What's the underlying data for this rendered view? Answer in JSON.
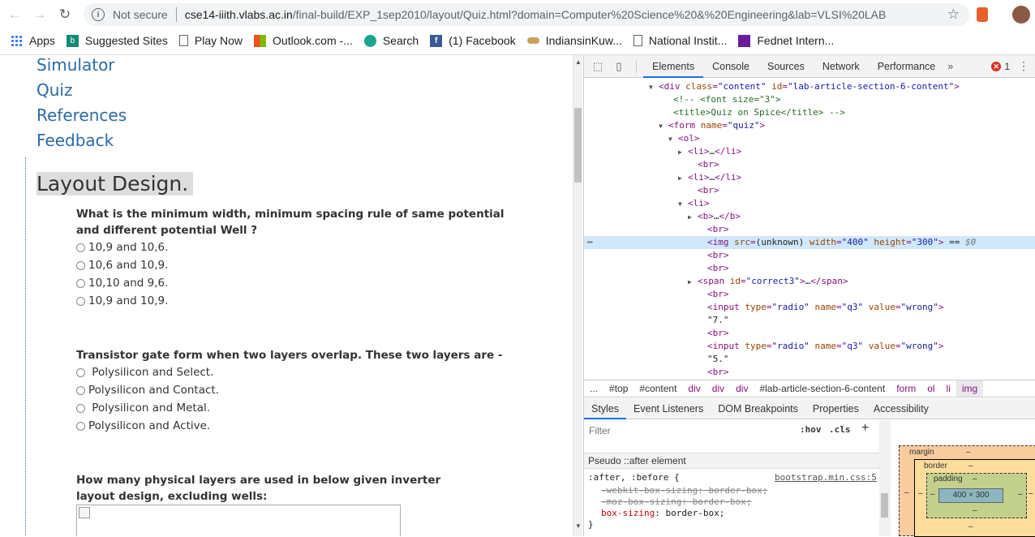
{
  "browser": {
    "address": {
      "security_label": "Not secure",
      "host": "cse14-iiith.vlabs.ac.in",
      "path": "/final-build/EXP_1sep2010/layout/Quiz.html?domain=Computer%20Science%20&%20Engineering&lab=VLSI%20LAB"
    },
    "bookmarks": [
      {
        "label": "Apps",
        "icon": "apps-grid-icon"
      },
      {
        "label": "Suggested Sites",
        "icon": "bing-icon"
      },
      {
        "label": "Play Now",
        "icon": "page-icon"
      },
      {
        "label": "Outlook.com -...",
        "icon": "outlook-icon"
      },
      {
        "label": "Search",
        "icon": "search-favicon"
      },
      {
        "label": "(1) Facebook",
        "icon": "facebook-icon"
      },
      {
        "label": "IndiansinKuw...",
        "icon": "indians-icon"
      },
      {
        "label": "National Instit...",
        "icon": "page-icon"
      },
      {
        "label": "Fednet Intern...",
        "icon": "fednet-icon"
      }
    ]
  },
  "page": {
    "nav_links": [
      "Simulator",
      "Quiz",
      "References",
      "Feedback"
    ],
    "section_title": "Layout Design.",
    "questions": [
      {
        "text": "What is the minimum width, minimum spacing rule of same potential and different potential Well ?",
        "options": [
          "10,9 and 10,6.",
          "10,6 and 10,9.",
          "10,10 and 9,6.",
          "10,9 and 10,9."
        ]
      },
      {
        "text": "Transistor gate form when two layers overlap. These two layers are -",
        "options": [
          " Polysilicon and Select.",
          "Polysilicon and Contact.",
          " Polysilicon and Metal.",
          "Polysilicon and Active."
        ]
      },
      {
        "text": "How many physical layers are used in below given inverter layout design, excluding wells:",
        "options": []
      }
    ]
  },
  "devtools": {
    "tabs": [
      "Elements",
      "Console",
      "Sources",
      "Network",
      "Performance"
    ],
    "more_tabs": "»",
    "error_count": "1",
    "dom_lines": [
      {
        "indent": 92,
        "tri": "▼",
        "html": "<span class='tag'>&lt;div</span> <span class='an'>class</span>=<span class='av'>\"content\"</span> <span class='an'>id</span>=<span class='av'>\"lab-article-section-6-content\"</span><span class='tag'>&gt;</span>"
      },
      {
        "indent": 110,
        "tri": "",
        "html": "<span class='cm'>&lt;!-- &lt;font size=\"3\"&gt;</span>"
      },
      {
        "indent": 110,
        "tri": "",
        "html": "<span class='cm'>&lt;title&gt;Quiz on Spice&lt;/title&gt; --&gt;</span>"
      },
      {
        "indent": 104,
        "tri": "▼",
        "html": "<span class='tag'>&lt;form</span> <span class='an'>name</span>=<span class='av'>\"quiz\"</span><span class='tag'>&gt;</span>"
      },
      {
        "indent": 116,
        "tri": "▼",
        "html": "<span class='tag'>&lt;ol&gt;</span>"
      },
      {
        "indent": 128,
        "tri": "▶",
        "html": "<span class='tag'>&lt;li&gt;</span><span class='tx'>…</span><span class='tag'>&lt;/li&gt;</span>"
      },
      {
        "indent": 140,
        "tri": "",
        "html": "<span class='tag'>&lt;br&gt;</span>"
      },
      {
        "indent": 128,
        "tri": "▶",
        "html": "<span class='tag'>&lt;li&gt;</span><span class='tx'>…</span><span class='tag'>&lt;/li&gt;</span>"
      },
      {
        "indent": 140,
        "tri": "",
        "html": "<span class='tag'>&lt;br&gt;</span>"
      },
      {
        "indent": 128,
        "tri": "▼",
        "html": "<span class='tag'>&lt;li&gt;</span>"
      },
      {
        "indent": 140,
        "tri": "▶",
        "html": "<span class='tag'>&lt;b&gt;</span><span class='tx'>…</span><span class='tag'>&lt;/b&gt;</span>"
      },
      {
        "indent": 152,
        "tri": "",
        "html": "<span class='tag'>&lt;br&gt;</span>"
      },
      {
        "indent": 152,
        "tri": "",
        "sel": true,
        "html": "<span class='tag'>&lt;img</span> <span class='an'>src</span>=<span class='tx'>(unknown)</span> <span class='an'>width</span>=<span class='av'>\"400\"</span> <span class='an'>height</span>=<span class='av'>\"300\"</span><span class='tag'>&gt;</span> <span class='tx'>==</span> <span class='tx' style='color:#777;font-style:italic'>$0</span>"
      },
      {
        "indent": 152,
        "tri": "",
        "html": "<span class='tag'>&lt;br&gt;</span>"
      },
      {
        "indent": 152,
        "tri": "",
        "html": "<span class='tag'>&lt;br&gt;</span>"
      },
      {
        "indent": 140,
        "tri": "▶",
        "html": "<span class='tag'>&lt;span</span> <span class='an'>id</span>=<span class='av'>\"correct3\"</span><span class='tag'>&gt;</span><span class='tx'>…</span><span class='tag'>&lt;/span&gt;</span>"
      },
      {
        "indent": 152,
        "tri": "",
        "html": "<span class='tag'>&lt;br&gt;</span>"
      },
      {
        "indent": 152,
        "tri": "",
        "html": "<span class='tag'>&lt;input</span> <span class='an'>type</span>=<span class='av'>\"radio\"</span> <span class='an'>name</span>=<span class='av'>\"q3\"</span> <span class='an'>value</span>=<span class='av'>\"wrong\"</span><span class='tag'>&gt;</span>"
      },
      {
        "indent": 152,
        "tri": "",
        "html": "<span class='tx'>\"7.\"</span>"
      },
      {
        "indent": 152,
        "tri": "",
        "html": "<span class='tag'>&lt;br&gt;</span>"
      },
      {
        "indent": 152,
        "tri": "",
        "html": "<span class='tag'>&lt;input</span> <span class='an'>type</span>=<span class='av'>\"radio\"</span> <span class='an'>name</span>=<span class='av'>\"q3\"</span> <span class='an'>value</span>=<span class='av'>\"wrong\"</span><span class='tag'>&gt;</span>"
      },
      {
        "indent": 152,
        "tri": "",
        "html": "<span class='tx'>\"5.\"</span>"
      },
      {
        "indent": 152,
        "tri": "",
        "html": "<span class='tag'>&lt;br&gt;</span>"
      }
    ],
    "breadcrumbs": [
      {
        "label": "...",
        "kind": "plain"
      },
      {
        "label": "#top",
        "kind": "plain"
      },
      {
        "label": "#content",
        "kind": "plain"
      },
      {
        "label": "div",
        "kind": "tag"
      },
      {
        "label": "div",
        "kind": "tag"
      },
      {
        "label": "div",
        "kind": "tag"
      },
      {
        "label": "#lab-article-section-6-content",
        "kind": "plain"
      },
      {
        "label": "form",
        "kind": "tag"
      },
      {
        "label": "ol",
        "kind": "tag"
      },
      {
        "label": "li",
        "kind": "tag"
      },
      {
        "label": "img",
        "kind": "active"
      }
    ],
    "sub_tabs": [
      "Styles",
      "Event Listeners",
      "DOM Breakpoints",
      "Properties",
      "Accessibility"
    ],
    "styles": {
      "filter_placeholder": "Filter",
      "hov": ":hov",
      "cls": ".cls",
      "pseudo_header": "Pseudo ::after element",
      "selector": ":after, :before {",
      "source": "bootstrap.min.css:5",
      "rules": [
        {
          "prop": "-webkit-box-sizing",
          "value": "border-box;",
          "struck": true
        },
        {
          "prop": "-moz-box-sizing",
          "value": "border-box;",
          "struck": true
        },
        {
          "prop": "box-sizing",
          "value": "border-box;",
          "struck": false
        }
      ],
      "close": "}"
    },
    "box_model": {
      "margin_label": "margin",
      "margin_value": "–",
      "border_label": "border",
      "border_value": "–",
      "padding_label": "padding",
      "padding_value": "–",
      "content": "400 × 300",
      "side_value": "–"
    }
  }
}
